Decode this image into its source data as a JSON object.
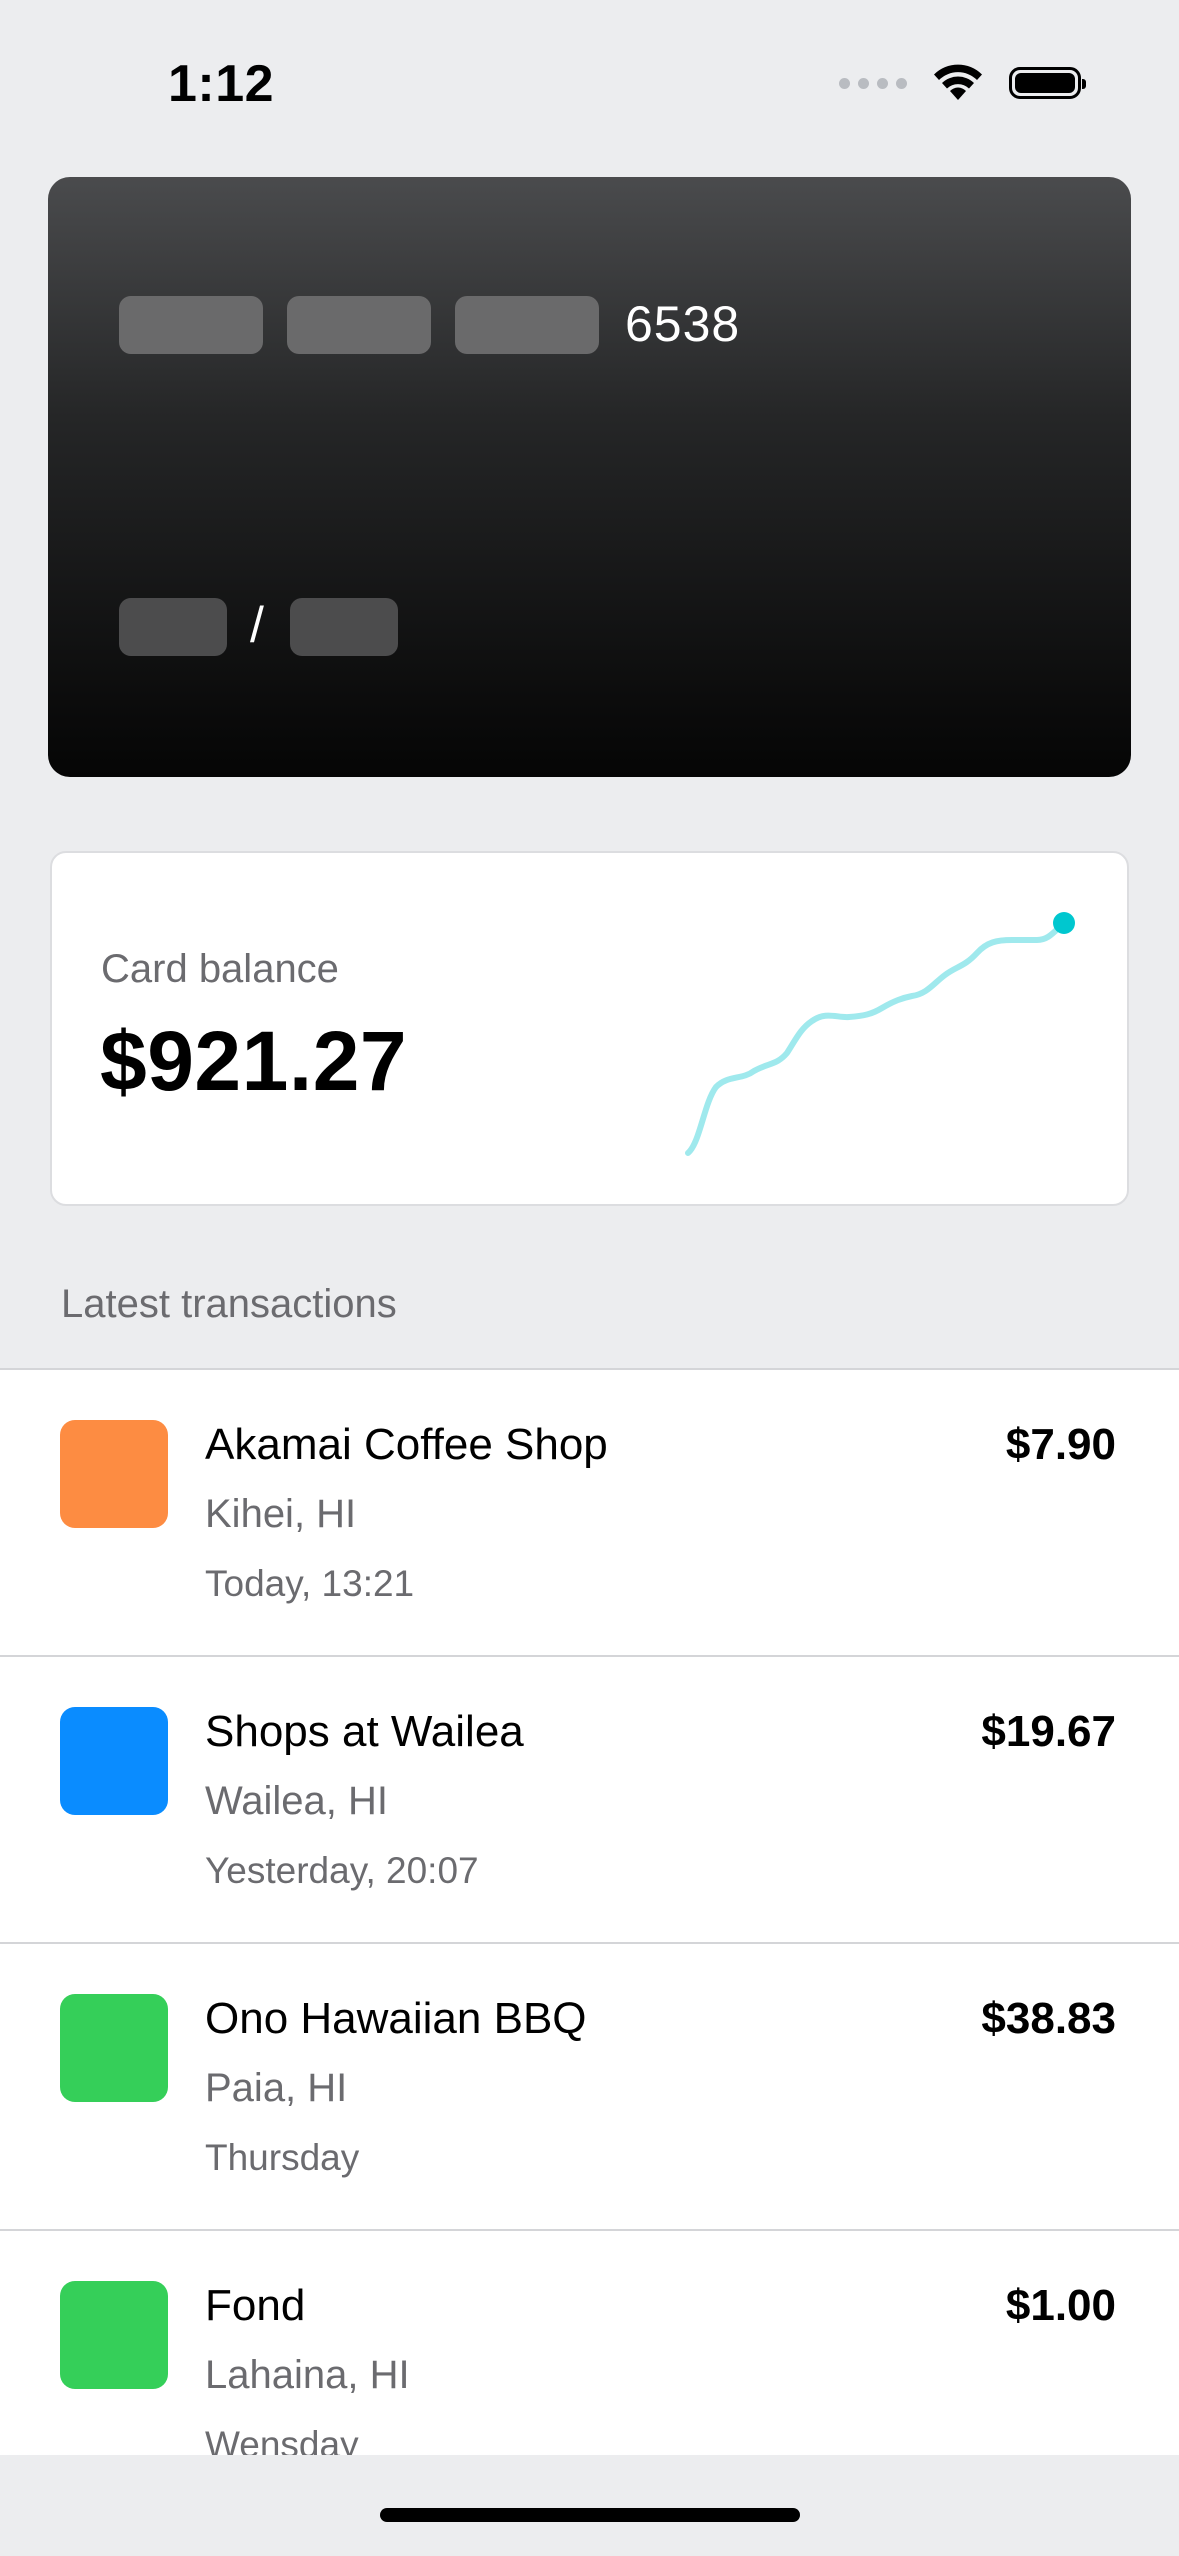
{
  "status_bar": {
    "time": "1:12",
    "icons": [
      "signal-dots-icon",
      "wifi-icon",
      "battery-icon"
    ]
  },
  "card": {
    "last4": "6538",
    "expiry_separator": "/"
  },
  "balance": {
    "label": "Card balance",
    "amount": "$921.27",
    "accent_color": "#00c7cf"
  },
  "transactions": {
    "header": "Latest transactions",
    "items": [
      {
        "name": "Akamai Coffee Shop",
        "location": "Kihei, HI",
        "time": "Today, 13:21",
        "amount": "$7.90",
        "color": "#fd8c42"
      },
      {
        "name": "Shops at Wailea",
        "location": "Wailea, HI",
        "time": "Yesterday, 20:07",
        "amount": "$19.67",
        "color": "#0a8cff"
      },
      {
        "name": "Ono Hawaiian BBQ",
        "location": "Paia, HI",
        "time": "Thursday",
        "amount": "$38.83",
        "color": "#35cf59"
      },
      {
        "name": "Fond",
        "location": "Lahaina, HI",
        "time": "Wensday",
        "amount": "$1.00",
        "color": "#35cf59"
      }
    ]
  }
}
